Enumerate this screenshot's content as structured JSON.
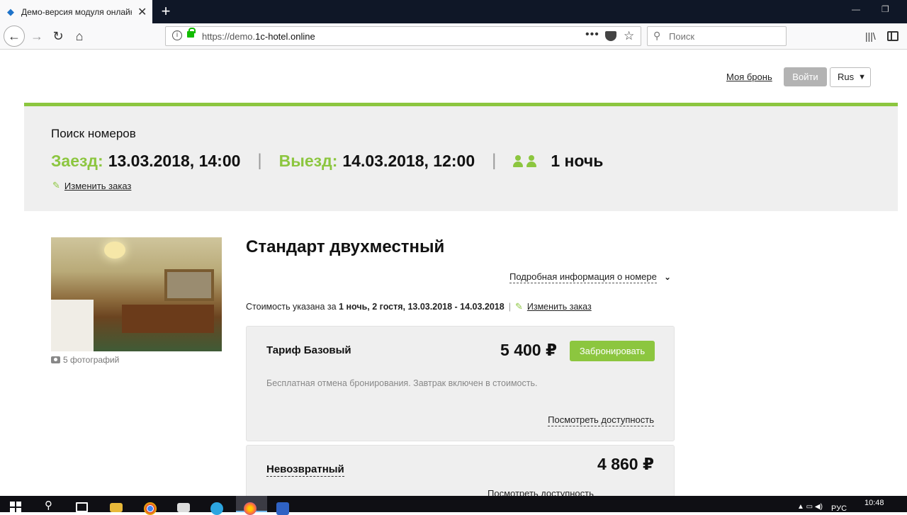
{
  "browser": {
    "tab_title": "Демо-версия модуля онлайн",
    "url_prefix": "https://demo.",
    "url_host": "1c-hotel.online",
    "search_placeholder": "Поиск"
  },
  "header": {
    "my_booking": "Моя бронь",
    "login": "Войти",
    "language": "Rus"
  },
  "search": {
    "title": "Поиск номеров",
    "checkin_label": "Заезд:",
    "checkin_value": "13.03.2018, 14:00",
    "checkout_label": "Выезд:",
    "checkout_value": "14.03.2018, 12:00",
    "nights": "1 ночь",
    "edit_order": "Изменить заказ"
  },
  "room": {
    "title": "Стандарт двухместный",
    "photos_count": "5 фотографий",
    "details_link": "Подробная информация о номере",
    "price_note_prefix": "Стоимость указана за",
    "price_note_bold": "1 ночь, 2 гостя, 13.03.2018 - 14.03.2018",
    "price_note_edit": "Изменить заказ",
    "tariffs": [
      {
        "name": "Тариф Базовый",
        "price": "5 400 ₽",
        "book_label": "Забронировать",
        "description": "Бесплатная отмена бронирования. Завтрак включен в стоимость.",
        "availability": "Посмотреть доступность"
      },
      {
        "name": "Невозвратный",
        "price": "4 860 ₽",
        "availability": "Посмотреть доступность"
      }
    ]
  },
  "taskbar": {
    "lang": "РУС",
    "time": "10:48"
  }
}
